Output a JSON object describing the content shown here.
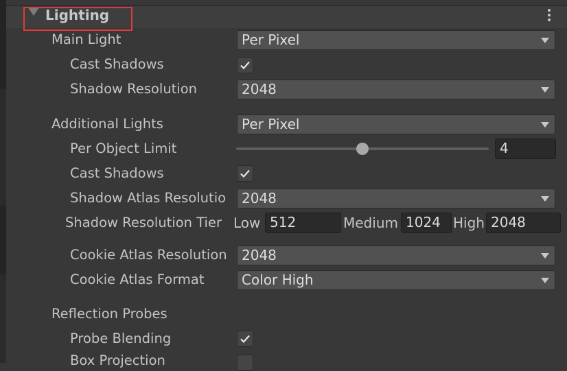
{
  "header": {
    "title": "Lighting",
    "menu_icon": "kebab-menu-icon",
    "highlight_color": "#e23a3a"
  },
  "main_light": {
    "label": "Main Light",
    "value": "Per Pixel",
    "cast_shadows": {
      "label": "Cast Shadows",
      "checked": true
    },
    "shadow_resolution": {
      "label": "Shadow Resolution",
      "value": "2048"
    }
  },
  "additional_lights": {
    "label": "Additional Lights",
    "value": "Per Pixel",
    "per_object_limit": {
      "label": "Per Object Limit",
      "value": "4"
    },
    "cast_shadows": {
      "label": "Cast Shadows",
      "checked": true
    },
    "shadow_atlas_resolution": {
      "label": "Shadow Atlas Resolutio",
      "value": "2048"
    },
    "shadow_resolution_tier": {
      "label": "Shadow Resolution Tier",
      "low": {
        "label": "Low",
        "value": "512"
      },
      "medium": {
        "label": "Medium",
        "value": "1024"
      },
      "high": {
        "label": "High",
        "value": "2048"
      }
    },
    "cookie_atlas_resolution": {
      "label": "Cookie Atlas Resolution",
      "value": "2048"
    },
    "cookie_atlas_format": {
      "label": "Cookie Atlas Format",
      "value": "Color High"
    }
  },
  "reflection_probes": {
    "label": "Reflection Probes",
    "probe_blending": {
      "label": "Probe Blending",
      "checked": true
    },
    "box_projection": {
      "label": "Box Projection",
      "checked": false
    }
  }
}
